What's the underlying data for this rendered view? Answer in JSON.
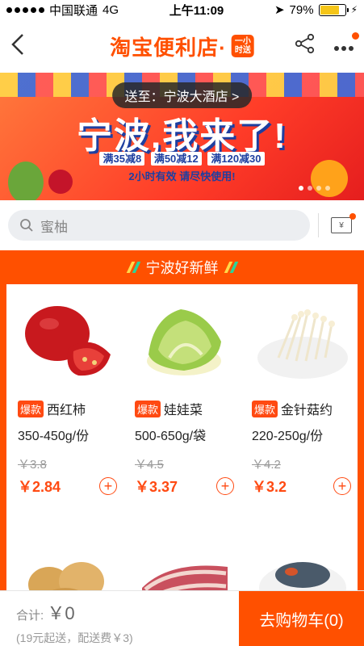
{
  "status": {
    "carrier": "中国联通",
    "network": "4G",
    "time": "上午11:09",
    "battery": "79%",
    "battery_level": 0.79
  },
  "nav": {
    "back": "<",
    "brand": "淘宝便利店·",
    "badge": "一小时送"
  },
  "banner": {
    "deliver_to": "送至：宁波大酒店 >",
    "headline": "宁波,我来了!",
    "promos": [
      "满35减8",
      "满50减12",
      "满120减30"
    ],
    "sub": "2小时有效 请尽快使用!"
  },
  "search": {
    "placeholder": "蜜柚",
    "coupon": "¥"
  },
  "section": {
    "title": "宁波好新鲜"
  },
  "products": [
    {
      "tag": "爆款",
      "name": "西红柿",
      "spec": "350-450g/份",
      "old_price": "￥3.8",
      "price": "￥2.84",
      "image": "tomato"
    },
    {
      "tag": "爆款",
      "name": "娃娃菜",
      "spec": "500-650g/袋",
      "old_price": "￥4.5",
      "price": "￥3.37",
      "image": "baby-cabbage"
    },
    {
      "tag": "爆款",
      "name": "金针菇约",
      "spec": "220-250g/份",
      "old_price": "￥4.2",
      "price": "￥3.2",
      "image": "enoki-mushroom"
    }
  ],
  "cart": {
    "total_label": "合计:",
    "total_value": "￥0",
    "note": "(19元起送，配送费￥3)",
    "button": "去购物车(0)"
  },
  "colors": {
    "accent": "#ff5000",
    "price": "#ff4a12"
  }
}
